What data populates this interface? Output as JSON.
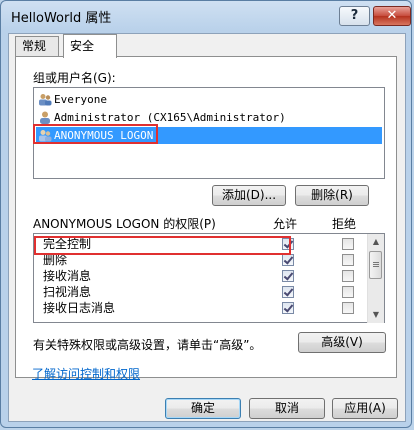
{
  "window": {
    "title": "HelloWorld 属性",
    "help_label": "?",
    "close_label": "✕"
  },
  "tabs": [
    {
      "label": "常规"
    },
    {
      "label": "安全"
    }
  ],
  "groups": {
    "label": "组或用户名(G):",
    "items": [
      {
        "label": "Everyone"
      },
      {
        "label": "Administrator (CX165\\Administrator)"
      },
      {
        "label": "ANONYMOUS LOGON"
      }
    ],
    "add_label": "添加(D)...",
    "remove_label": "删除(R)"
  },
  "permissions": {
    "title": "ANONYMOUS LOGON 的权限(P)",
    "allow_header": "允许",
    "deny_header": "拒绝",
    "rows": [
      {
        "name": "完全控制",
        "allow": true,
        "deny": false
      },
      {
        "name": "删除",
        "allow": true,
        "deny": false
      },
      {
        "name": "接收消息",
        "allow": true,
        "deny": false
      },
      {
        "name": "扫视消息",
        "allow": true,
        "deny": false
      },
      {
        "name": "接收日志消息",
        "allow": true,
        "deny": false
      }
    ]
  },
  "advanced": {
    "text": "有关特殊权限或高级设置，请单击“高级”。",
    "button_label": "高级(V)"
  },
  "link_text": "了解访问控制和权限",
  "footer": {
    "ok_label": "确定",
    "cancel_label": "取消",
    "apply_label": "应用(A)"
  },
  "colors": {
    "selection": "#3399ff",
    "highlight": "#e03030",
    "link": "#0066cc"
  }
}
